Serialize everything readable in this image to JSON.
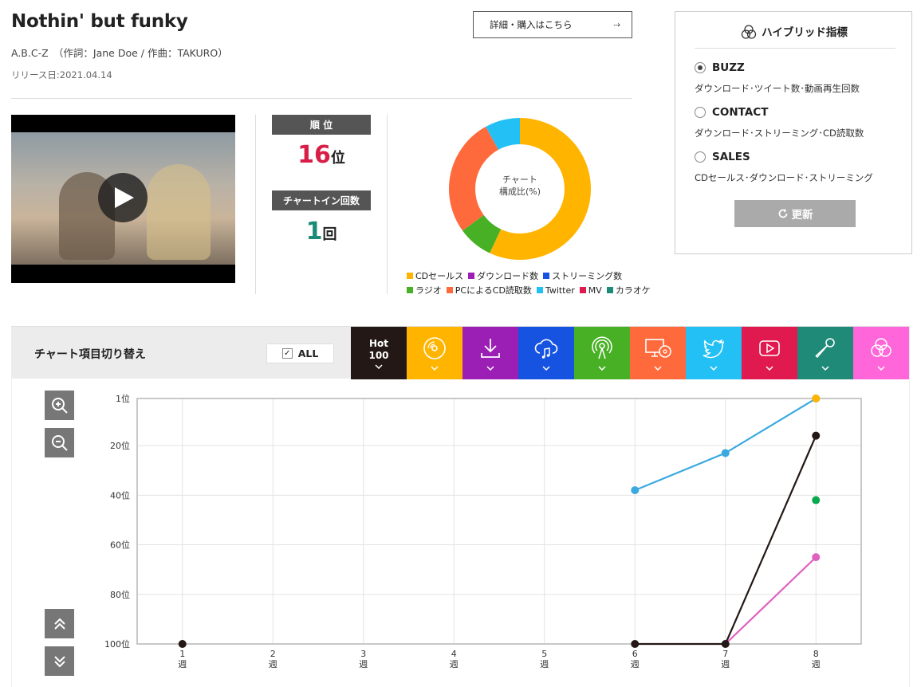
{
  "song": {
    "title": "Nothin' but funky",
    "credit": "A.B.C-Z　（作詞：Jane Doe / 作曲：TAKURO）",
    "release": "リリース日:2021.04.14",
    "detail_button": "詳細・購入はこちら",
    "detail_arrow": "⤑"
  },
  "stats": {
    "rank_label": "順 位",
    "rank_value": "16",
    "rank_unit": "位",
    "chartin_label": "チャートイン回数",
    "chartin_value": "1",
    "chartin_unit": "回"
  },
  "composition": {
    "center_line1": "チャート",
    "center_line2": "構成比(%)",
    "slices": [
      {
        "name": "CDセールス",
        "value": 57,
        "color": "#ffb400"
      },
      {
        "name": "ラジオ",
        "value": 8,
        "color": "#48b025"
      },
      {
        "name": "PCによるCD読取数",
        "value": 27,
        "color": "#ff6a3d"
      },
      {
        "name": "Twitter",
        "value": 8,
        "color": "#23c0f5"
      }
    ],
    "legend_rows": [
      [
        {
          "label": "CDセールス",
          "color": "#ffb400"
        },
        {
          "label": "ダウンロード数",
          "color": "#9b1fb5"
        },
        {
          "label": "ストリーミング数",
          "color": "#1553e0"
        }
      ],
      [
        {
          "label": "ラジオ",
          "color": "#48b025"
        },
        {
          "label": "PCによるCD読取数",
          "color": "#ff6a3d"
        },
        {
          "label": "Twitter",
          "color": "#23c0f5"
        },
        {
          "label": "MV",
          "color": "#e0194f"
        },
        {
          "label": "カラオケ",
          "color": "#1f8a78"
        }
      ]
    ]
  },
  "hybrid": {
    "title": "ハイブリッド指標",
    "options": [
      {
        "label": "BUZZ",
        "desc": "ダウンロード･ツイート数･動画再生回数",
        "selected": true
      },
      {
        "label": "CONTACT",
        "desc": "ダウンロード･ストリーミング･CD読取数",
        "selected": false
      },
      {
        "label": "SALES",
        "desc": "CDセールス･ダウンロード･ストリーミング",
        "selected": false
      }
    ],
    "refresh_label": "更新"
  },
  "switcher": {
    "label": "チャート項目切り替え",
    "all_label": "ALL",
    "all_check": "✓",
    "hot_line1": "Hot",
    "hot_line2": "100",
    "tabs": [
      {
        "name": "hot100",
        "color": "#231815"
      },
      {
        "name": "cd-sales",
        "color": "#ffb400"
      },
      {
        "name": "download",
        "color": "#9b1fb5"
      },
      {
        "name": "streaming",
        "color": "#1553e0"
      },
      {
        "name": "radio",
        "color": "#48b025"
      },
      {
        "name": "pc-cd-read",
        "color": "#ff6a3d"
      },
      {
        "name": "twitter",
        "color": "#23c0f5"
      },
      {
        "name": "mv",
        "color": "#e0194f"
      },
      {
        "name": "karaoke",
        "color": "#1f8a78"
      },
      {
        "name": "hybrid",
        "color": "#ff66d9"
      }
    ]
  },
  "chart_data": {
    "type": "line",
    "x": [
      1,
      2,
      3,
      4,
      5,
      6,
      7,
      8
    ],
    "x_tick_labels": [
      "1\n週",
      "2\n週",
      "3\n週",
      "4\n週",
      "5\n週",
      "6\n週",
      "7\n週",
      "8\n週"
    ],
    "y_ticks": [
      1,
      20,
      40,
      60,
      80,
      100
    ],
    "y_tick_labels": [
      "1位",
      "20位",
      "40位",
      "60位",
      "80位",
      "100位"
    ],
    "ylim": [
      1,
      100
    ],
    "y_inverted": true,
    "grid": true,
    "series": [
      {
        "color": "#231815",
        "points": [
          [
            1,
            100
          ],
          [
            6,
            100
          ],
          [
            7,
            100
          ],
          [
            8,
            16
          ]
        ],
        "connect_from_index": 1
      },
      {
        "color": "#3aa9e0",
        "points": [
          [
            6,
            38
          ],
          [
            7,
            23
          ],
          [
            8,
            1
          ]
        ],
        "connect_from_index": 0
      },
      {
        "color": "#e060c0",
        "points": [
          [
            7,
            100
          ],
          [
            8,
            65
          ]
        ],
        "connect_from_index": 0,
        "hide_points": [
          0
        ]
      },
      {
        "color": "#ffb400",
        "points": [
          [
            8,
            1
          ]
        ],
        "connect_from_index": 0
      },
      {
        "color": "#0aa84f",
        "points": [
          [
            8,
            42
          ]
        ],
        "connect_from_index": 0
      }
    ]
  }
}
